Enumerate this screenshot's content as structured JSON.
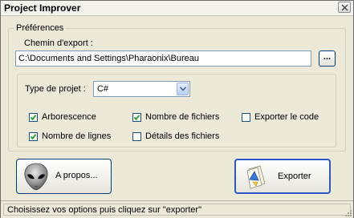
{
  "window": {
    "title": "Project Improver"
  },
  "preferences": {
    "group_label": "Préférences",
    "export_path_label": "Chemin d'export :",
    "export_path_value": "C:\\Documents and Settings\\Pharaonix\\Bureau",
    "browse_label": "..."
  },
  "project": {
    "type_label": "Type de projet :",
    "type_value": "C#"
  },
  "options": {
    "arborescence": {
      "label": "Arborescence",
      "checked": true
    },
    "nombre_fichiers": {
      "label": "Nombre de fichiers",
      "checked": true
    },
    "exporter_code": {
      "label": "Exporter le code",
      "checked": false
    },
    "nombre_lignes": {
      "label": "Nombre de lignes",
      "checked": true
    },
    "details_fichiers": {
      "label": "Détails des fichiers",
      "checked": false
    }
  },
  "buttons": {
    "about_label": "A propos...",
    "export_label": "Exporter"
  },
  "status": {
    "text": "Choisissez vos options puis cliquez sur \"exporter\""
  },
  "icons": {
    "close": "close-icon",
    "alien": "alien-head-icon",
    "export": "export-document-icon",
    "dropdown": "chevron-down-icon",
    "grip": "resize-grip-icon"
  }
}
